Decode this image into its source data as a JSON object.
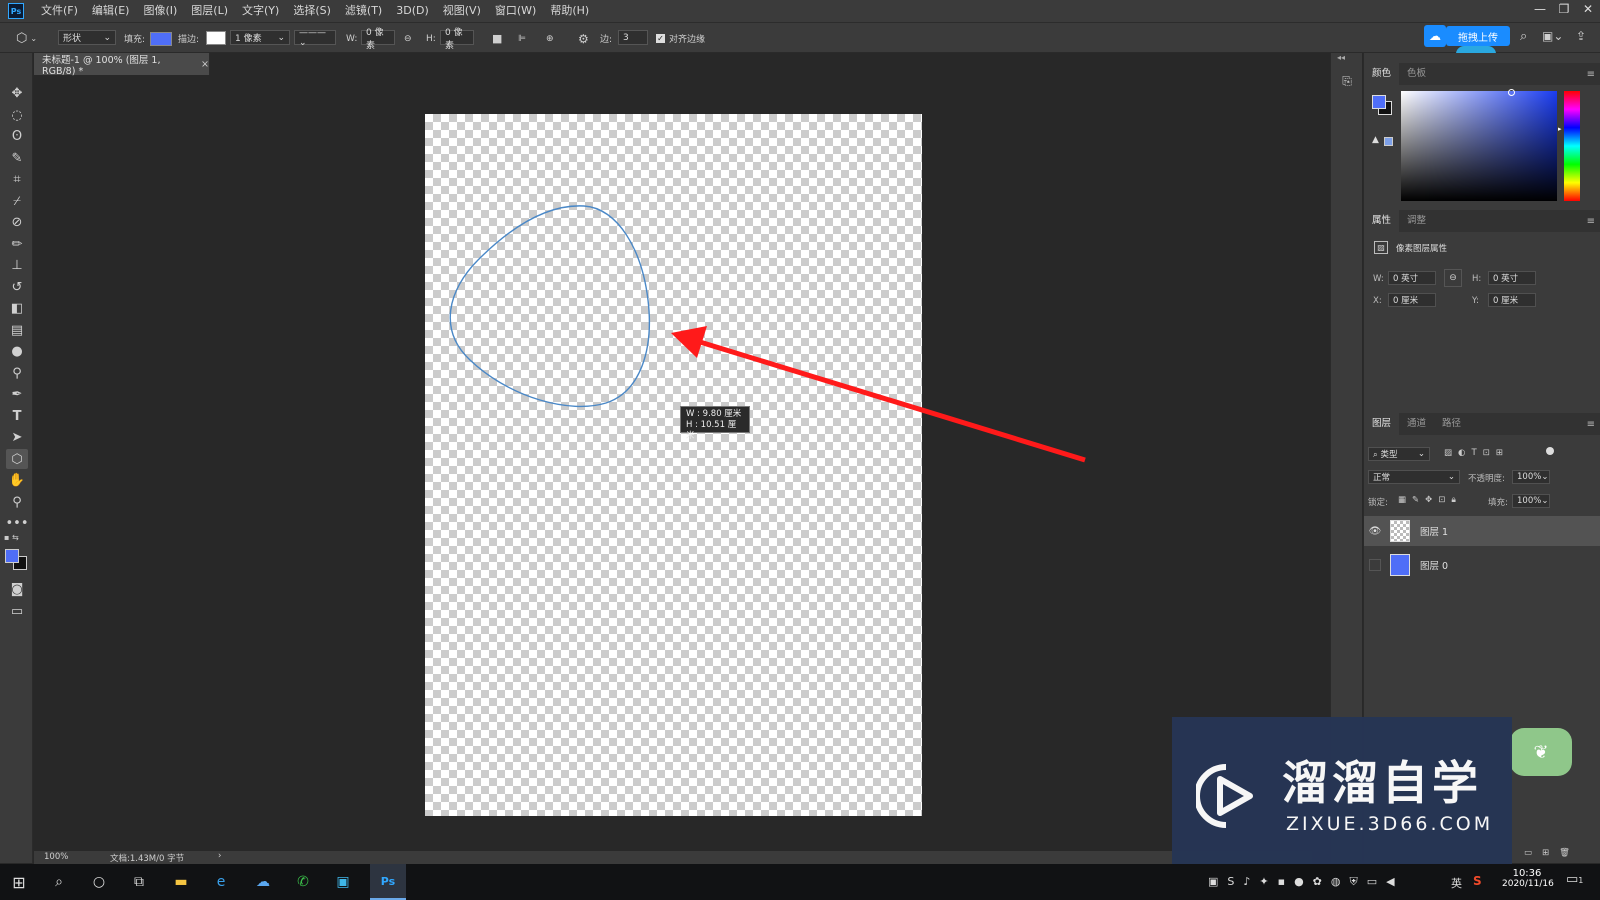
{
  "app": {
    "logo": "Ps"
  },
  "menu": [
    "文件(F)",
    "编辑(E)",
    "图像(I)",
    "图层(L)",
    "文字(Y)",
    "选择(S)",
    "滤镜(T)",
    "3D(D)",
    "视图(V)",
    "窗口(W)",
    "帮助(H)"
  ],
  "options": {
    "mode": "形状",
    "fill_label": "填充:",
    "stroke_label": "描边:",
    "stroke_width": "1 像素",
    "w_label": "W:",
    "w_value": "0 像素",
    "h_label": "H:",
    "h_value": "0 像素",
    "sides_label": "边:",
    "sides_value": "3",
    "align_edges": "对齐边缘",
    "upload": "拖拽上传"
  },
  "document": {
    "tab_title": "未标题-1 @ 100% (图层 1, RGB/8) *",
    "tooltip_w": "W :   9.80 厘米",
    "tooltip_h": "H :  10.51 厘米",
    "zoom": "100%",
    "doc_info": "文档:1.43M/0 字节"
  },
  "color_panel": {
    "tabs": [
      "颜色",
      "色板"
    ],
    "fg": "#4f6ef7",
    "bg": "#111111"
  },
  "properties_panel": {
    "tabs": [
      "属性",
      "调整"
    ],
    "title": "像素图层属性",
    "w_label": "W:",
    "w_value": "0 英寸",
    "h_label": "H:",
    "h_value": "0 英寸",
    "x_label": "X:",
    "x_value": "0 厘米",
    "y_label": "Y:",
    "y_value": "0 厘米"
  },
  "layers_panel": {
    "tabs": [
      "图层",
      "通道",
      "路径"
    ],
    "filter_kind": "类型",
    "blend_mode": "正常",
    "opacity_label": "不透明度:",
    "opacity_value": "100%",
    "lock_label": "锁定:",
    "fill_label": "填充:",
    "fill_value": "100%",
    "layers": [
      {
        "name": "图层 1",
        "visible": true,
        "thumb": "transparent",
        "selected": true
      },
      {
        "name": "图层 0",
        "visible": false,
        "thumb": "#4f6ef7",
        "selected": false
      }
    ]
  },
  "watermark": {
    "brand": "溜溜自学",
    "url": "ZIXUE.3D66.COM"
  },
  "taskbar": {
    "time": "10:36",
    "date": "2020/11/16",
    "ime": "英",
    "notify_count": "1"
  },
  "colors": {
    "accent": "#31a8ff",
    "arrow": "#ff1a1a",
    "shape_stroke": "#4a88c7"
  }
}
